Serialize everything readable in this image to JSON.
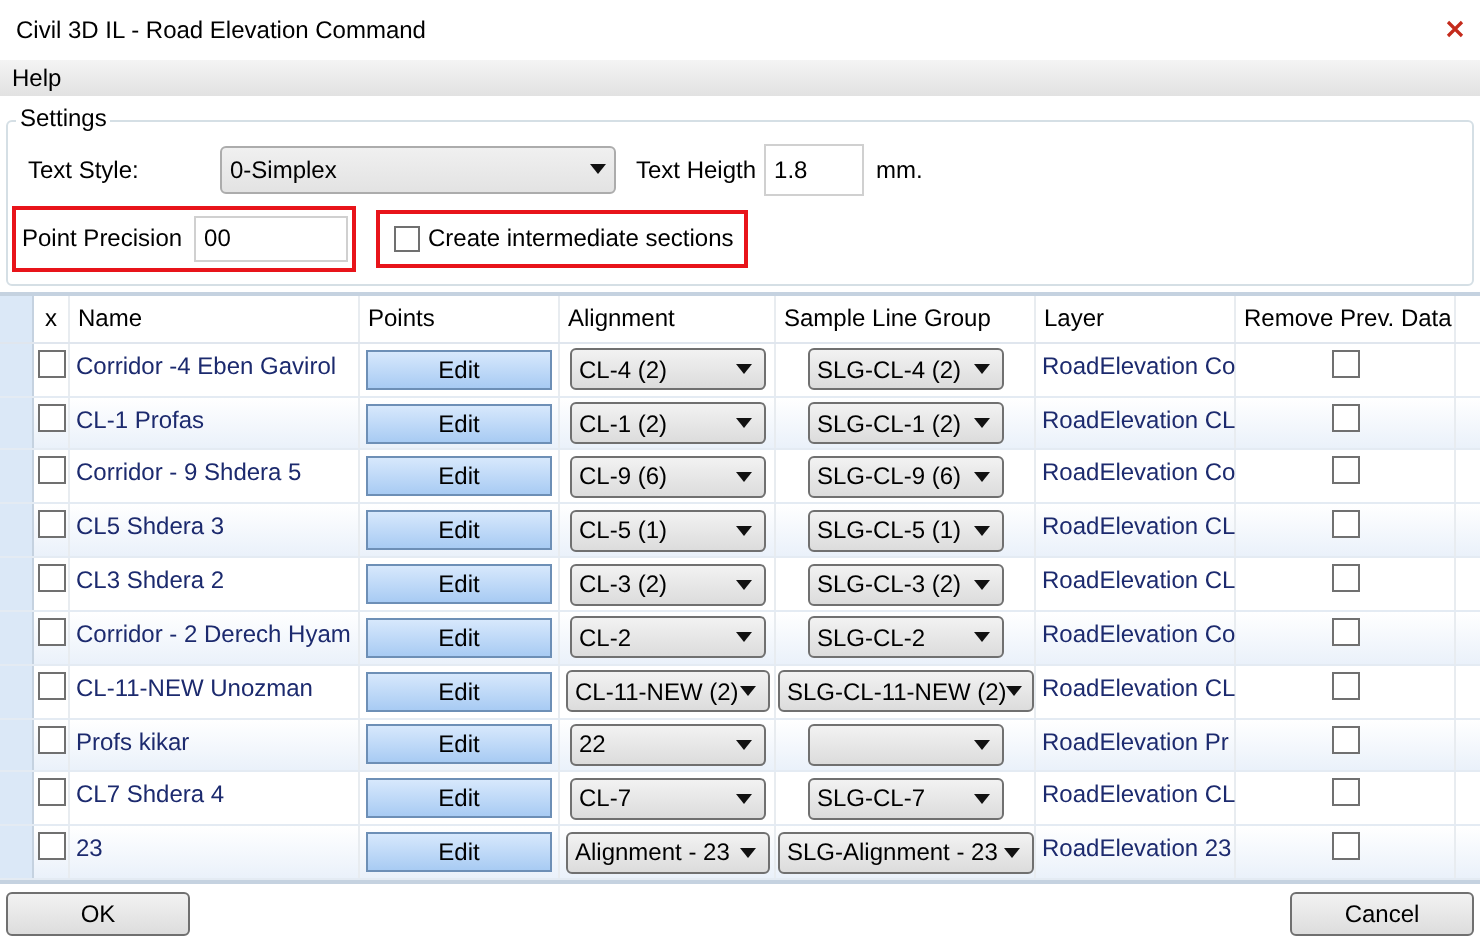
{
  "window": {
    "title": "Civil 3D IL - Road Elevation Command"
  },
  "menu": [
    "Help"
  ],
  "settings": {
    "title": "Settings",
    "text_style": {
      "label": "Text Style:",
      "value": "0-Simplex"
    },
    "text_height": {
      "label": "Text Heigth",
      "value": "1.8",
      "unit": "mm."
    },
    "point_precision": {
      "label": "Point Precision",
      "value": "00",
      "highlighted": true
    },
    "intermediate_sections": {
      "label": "Create intermediate sections",
      "checked": false,
      "highlighted": true
    }
  },
  "table": {
    "columns": [
      "x",
      "Name",
      "Points",
      "Alignment",
      "Sample Line Group",
      "Layer",
      "Remove Prev. Data"
    ],
    "rows": [
      {
        "checked": false,
        "name": "Corridor -4 Eben Gavirol",
        "points": "Edit",
        "alignment": "CL-4 (2)",
        "sample_line_group": "SLG-CL-4 (2)",
        "layer": "RoadElevation Co",
        "remove_prev_data": false
      },
      {
        "checked": false,
        "name": "CL-1 Profas",
        "points": "Edit",
        "alignment": "CL-1 (2)",
        "sample_line_group": "SLG-CL-1 (2)",
        "layer": "RoadElevation CL",
        "remove_prev_data": false
      },
      {
        "checked": false,
        "name": "Corridor - 9 Shdera 5",
        "points": "Edit",
        "alignment": "CL-9 (6)",
        "sample_line_group": "SLG-CL-9 (6)",
        "layer": "RoadElevation Co",
        "remove_prev_data": false
      },
      {
        "checked": false,
        "name": "CL5 Shdera 3",
        "points": "Edit",
        "alignment": "CL-5 (1)",
        "sample_line_group": "SLG-CL-5 (1)",
        "layer": "RoadElevation CL",
        "remove_prev_data": false
      },
      {
        "checked": false,
        "name": "CL3 Shdera 2",
        "points": "Edit",
        "alignment": "CL-3 (2)",
        "sample_line_group": "SLG-CL-3 (2)",
        "layer": "RoadElevation CL",
        "remove_prev_data": false
      },
      {
        "checked": false,
        "name": "Corridor - 2 Derech Hyam",
        "points": "Edit",
        "alignment": "CL-2",
        "sample_line_group": "SLG-CL-2",
        "layer": "RoadElevation Co",
        "remove_prev_data": false
      },
      {
        "checked": false,
        "name": "CL-11-NEW Unozman",
        "points": "Edit",
        "alignment": "CL-11-NEW (2)",
        "sample_line_group": "SLG-CL-11-NEW (2)",
        "layer": "RoadElevation CL",
        "remove_prev_data": false
      },
      {
        "checked": false,
        "name": "Profs kikar",
        "points": "Edit",
        "alignment": "22",
        "layer": "RoadElevation Pr",
        "remove_prev_data": false
      },
      {
        "checked": false,
        "name": "CL7 Shdera 4",
        "points": "Edit",
        "alignment": "CL-7",
        "sample_line_group": "SLG-CL-7",
        "layer": "RoadElevation CL",
        "remove_prev_data": false
      },
      {
        "checked": false,
        "name": "23",
        "points": "Edit",
        "alignment": "Alignment - 23",
        "sample_line_group": "SLG-Alignment - 23",
        "layer": "RoadElevation 23",
        "remove_prev_data": false
      }
    ]
  },
  "buttons": [
    "OK",
    "Cancel"
  ]
}
